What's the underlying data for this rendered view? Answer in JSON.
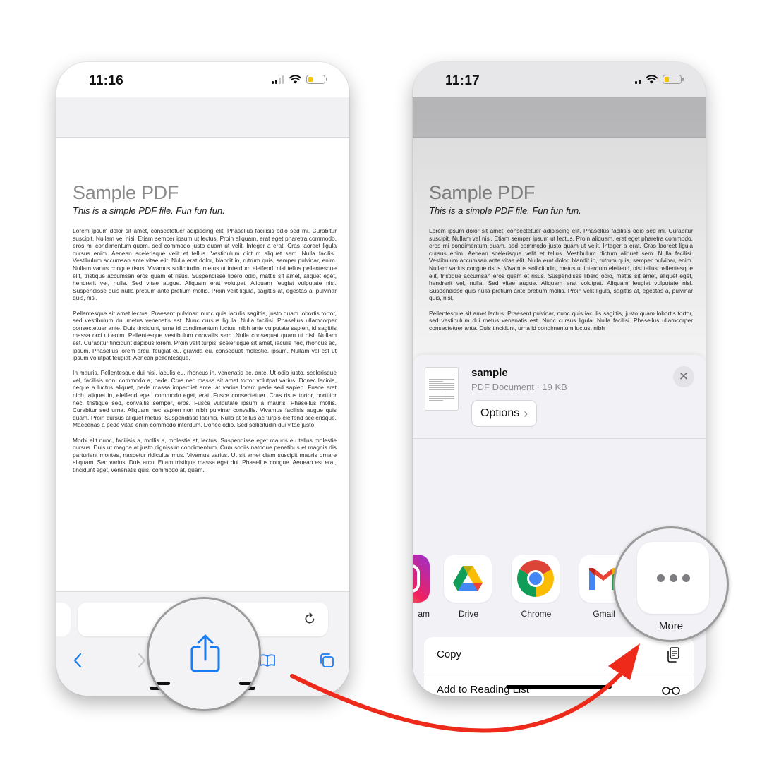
{
  "left_phone": {
    "time": "11:16",
    "document": {
      "title": "Sample PDF",
      "subtitle": "This is a simple PDF file. Fun fun fun.",
      "paragraphs": [
        "Lorem ipsum dolor sit amet, consectetuer adipiscing elit. Phasellus facilisis odio sed mi. Curabitur suscipit. Nullam vel nisi. Etiam semper ipsum ut lectus. Proin aliquam, erat eget pharetra commodo, eros mi condimentum quam, sed commodo justo quam ut velit. Integer a erat. Cras laoreet ligula cursus enim. Aenean scelerisque velit et tellus. Vestibulum dictum aliquet sem. Nulla facilisi. Vestibulum accumsan ante vitae elit. Nulla erat dolor, blandit in, rutrum quis, semper pulvinar, enim. Nullam varius congue risus. Vivamus sollicitudin, metus ut interdum eleifend, nisi tellus pellentesque elit, tristique accumsan eros quam et risus. Suspendisse libero odio, mattis sit amet, aliquet eget, hendrerit vel, nulla. Sed vitae augue. Aliquam erat volutpat. Aliquam feugiat vulputate nisl. Suspendisse quis nulla pretium ante pretium mollis. Proin velit ligula, sagittis at, egestas a, pulvinar quis, nisl.",
        "Pellentesque sit amet lectus. Praesent pulvinar, nunc quis iaculis sagittis, justo quam lobortis tortor, sed vestibulum dui metus venenatis est. Nunc cursus ligula. Nulla facilisi. Phasellus ullamcorper consectetuer ante. Duis tincidunt, urna id condimentum luctus, nibh ante vulputate sapien, id sagittis massa orci ut enim. Pellentesque vestibulum convallis sem. Nulla consequat quam ut nisl. Nullam est. Curabitur tincidunt dapibus lorem. Proin velit turpis, scelerisque sit amet, iaculis nec, rhoncus ac, ipsum. Phasellus lorem arcu, feugiat eu, gravida eu, consequat molestie, ipsum. Nullam vel est ut ipsum volutpat feugiat. Aenean pellentesque.",
        "In mauris. Pellentesque dui nisi, iaculis eu, rhoncus in, venenatis ac, ante. Ut odio justo, scelerisque vel, facilisis non, commodo a, pede. Cras nec massa sit amet tortor volutpat varius. Donec lacinia, neque a luctus aliquet, pede massa imperdiet ante, at varius lorem pede sed sapien. Fusce erat nibh, aliquet in, eleifend eget, commodo eget, erat. Fusce consectetuer. Cras risus tortor, porttitor nec, tristique sed, convallis semper, eros. Fusce vulputate ipsum a mauris. Phasellus mollis. Curabitur sed urna. Aliquam nec sapien non nibh pulvinar convallis. Vivamus facilisis augue quis quam. Proin cursus aliquet metus. Suspendisse lacinia. Nulla at tellus ac turpis eleifend scelerisque. Maecenas a pede vitae enim commodo interdum. Donec odio. Sed sollicitudin dui vitae justo.",
        "Morbi elit nunc, facilisis a, mollis a, molestie at, lectus. Suspendisse eget mauris eu tellus molestie cursus. Duis ut magna at justo dignissim condimentum. Cum sociis natoque penatibus et magnis dis parturient montes, nascetur ridiculus mus. Vivamus varius. Ut sit amet diam suscipit mauris ornare aliquam. Sed varius. Duis arcu. Etiam tristique massa eget dui. Phasellus congue. Aenean est erat, tincidunt eget, venenatis quis, commodo at, quam."
      ]
    },
    "toolbar_icons": [
      "back-icon",
      "forward-icon",
      "share-icon",
      "bookmarks-icon",
      "tabs-icon"
    ]
  },
  "right_phone": {
    "time": "11:17",
    "document": {
      "title": "Sample PDF",
      "subtitle": "This is a simple PDF file. Fun fun fun.",
      "paragraphs": [
        "Lorem ipsum dolor sit amet, consectetuer adipiscing elit. Phasellus facilisis odio sed mi. Curabitur suscipit. Nullam vel nisi. Etiam semper ipsum ut lectus. Proin aliquam, erat eget pharetra commodo, eros mi condimentum quam, sed commodo justo quam ut velit. Integer a erat. Cras laoreet ligula cursus enim. Aenean scelerisque velit et tellus. Vestibulum dictum aliquet sem. Nulla facilisi. Vestibulum accumsan ante vitae elit. Nulla erat dolor, blandit in, rutrum quis, semper pulvinar, enim. Nullam varius congue risus. Vivamus sollicitudin, metus ut interdum eleifend, nisi tellus pellentesque elit, tristique accumsan eros quam et risus. Suspendisse libero odio, mattis sit amet, aliquet eget, hendrerit vel, nulla. Sed vitae augue. Aliquam erat volutpat. Aliquam feugiat vulputate nisl. Suspendisse quis nulla pretium ante pretium mollis. Proin velit ligula, sagittis at, egestas a, pulvinar quis, nisl.",
        "Pellentesque sit amet lectus. Praesent pulvinar, nunc quis iaculis sagittis, justo quam lobortis tortor, sed vestibulum dui metus venenatis est. Nunc cursus ligula. Nulla facilisi. Phasellus ullamcorper consectetuer ante. Duis tincidunt, urna id condimentum luctus, nibh"
      ]
    },
    "share_sheet": {
      "file_name": "sample",
      "file_meta": "PDF Document · 19 KB",
      "options_label": "Options",
      "options_chevron": "›",
      "close_glyph": "✕",
      "apps": [
        {
          "label": "am",
          "icon": "instagram-icon"
        },
        {
          "label": "Drive",
          "icon": "google-drive-icon"
        },
        {
          "label": "Chrome",
          "icon": "chrome-icon"
        },
        {
          "label": "Gmail",
          "icon": "gmail-icon"
        }
      ],
      "more_label": "More",
      "actions": [
        {
          "label": "Copy",
          "icon": "copy-icon"
        },
        {
          "label": "Add to Reading List",
          "icon": "reading-list-icon"
        }
      ]
    }
  },
  "colors": {
    "ios_blue": "#1a7cf5",
    "arrow_red": "#ee2a1b",
    "battery_yellow": "#f5c400"
  }
}
